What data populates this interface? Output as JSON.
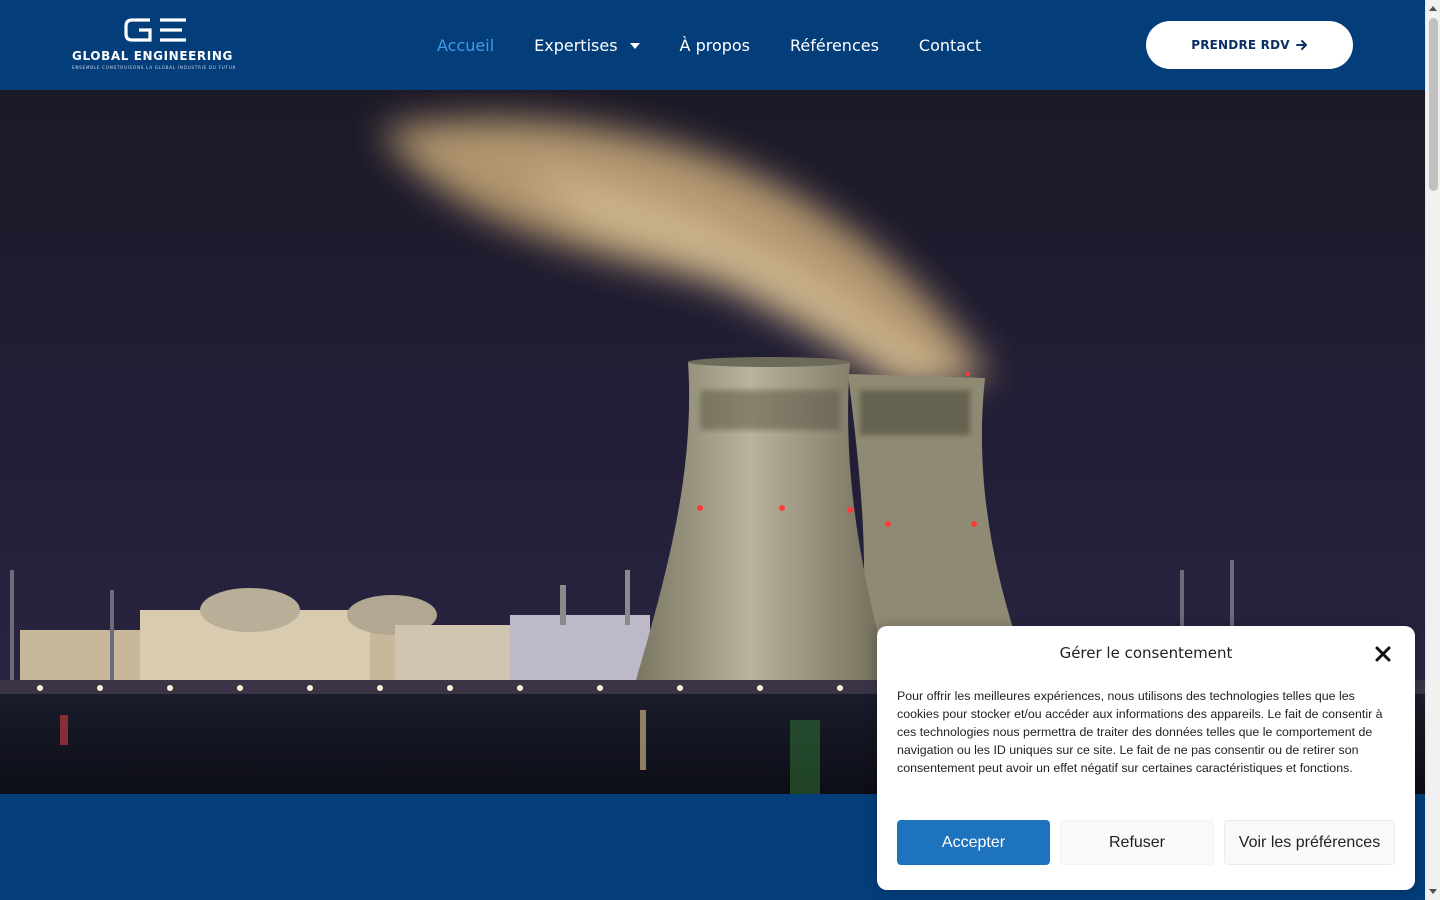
{
  "colors": {
    "header_bg": "#033E7A",
    "nav_active": "#3E9BEA",
    "accept_button": "#1E73BE",
    "cta_text": "#0B2F66"
  },
  "logo": {
    "mark": "GE",
    "name": "GLOBAL ENGINEERING",
    "tagline": "ENSEMBLE CONSTRUISONS LA GLOBAL INDUSTRIE DU FUTUR"
  },
  "nav": {
    "items": [
      {
        "label": "Accueil",
        "active": true
      },
      {
        "label": "Expertises",
        "has_dropdown": true,
        "icon": "caret-down-icon"
      },
      {
        "label": "À propos"
      },
      {
        "label": "Références"
      },
      {
        "label": "Contact"
      }
    ]
  },
  "header": {
    "cta_label": "PRENDRE RDV",
    "cta_icon": "arrow-right-icon"
  },
  "hero": {
    "image": "nuclear-power-plant-cooling-towers-at-night"
  },
  "consent": {
    "title": "Gérer le consentement",
    "close_icon": "close-icon",
    "text": "Pour offrir les meilleures expériences, nous utilisons des technologies telles que les cookies pour stocker et/ou accéder aux informations des appareils. Le fait de consentir à ces technologies nous permettra de traiter des données telles que le comportement de navigation ou les ID uniques sur ce site. Le fait de ne pas consentir ou de retirer son consentement peut avoir un effet négatif sur certaines caractéristiques et fonctions.",
    "accept_label": "Accepter",
    "refuse_label": "Refuser",
    "preferences_label": "Voir les préférences"
  }
}
